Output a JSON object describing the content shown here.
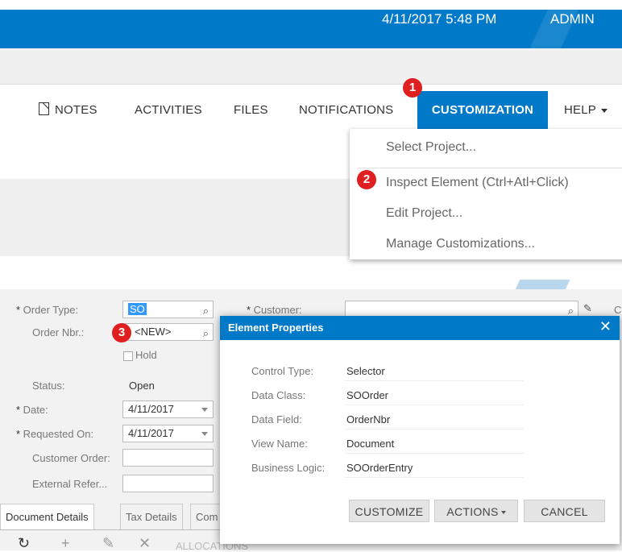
{
  "header": {
    "datetime": "4/11/2017  5:48 PM",
    "user": "ADMIN"
  },
  "toolbar": {
    "notes": "NOTES",
    "activities": "ACTIVITIES",
    "files": "FILES",
    "notifications": "NOTIFICATIONS",
    "customization": "CUSTOMIZATION",
    "help": "HELP"
  },
  "customization_menu": {
    "items": [
      "Select Project...",
      "Inspect Element (Ctrl+Atl+Click)",
      "Edit Project...",
      "Manage Customizations..."
    ]
  },
  "badges": [
    "1",
    "2",
    "3"
  ],
  "form": {
    "order_type_label": "Order Type:",
    "order_type_value": "SO",
    "order_nbr_label": "Order Nbr.:",
    "order_nbr_value": "<NEW>",
    "hold_label": "Hold",
    "status_label": "Status:",
    "status_value": "Open",
    "date_label": "Date:",
    "date_value": "4/11/2017",
    "requested_on_label": "Requested On:",
    "requested_on_value": "4/11/2017",
    "customer_order_label": "Customer Order:",
    "external_ref_label": "External Refer...",
    "customer_label": "Customer:",
    "right_cutoff": "C"
  },
  "tabs": [
    "Document Details",
    "Tax Details",
    "Com"
  ],
  "bottom_toolbar": {
    "partial_label": "ALLOCATIONS"
  },
  "dialog": {
    "title": "Element Properties",
    "close": "✕",
    "properties": [
      {
        "label": "Control Type:",
        "value": "Selector"
      },
      {
        "label": "Data Class:",
        "value": "SOOrder"
      },
      {
        "label": "Data Field:",
        "value": "OrderNbr"
      },
      {
        "label": "View Name:",
        "value": "Document"
      },
      {
        "label": "Business Logic:",
        "value": "SOOrderEntry"
      }
    ],
    "buttons": {
      "customize": "CUSTOMIZE",
      "actions": "ACTIONS",
      "cancel": "CANCEL"
    }
  },
  "colors": {
    "accent": "#0079c9",
    "badge": "#e02020",
    "selection": "#3399ff"
  },
  "icons": [
    "notes-icon",
    "search-icon",
    "dropdown-arrow-icon",
    "pencil-icon",
    "close-icon",
    "refresh-icon",
    "add-icon",
    "delete-icon"
  ]
}
